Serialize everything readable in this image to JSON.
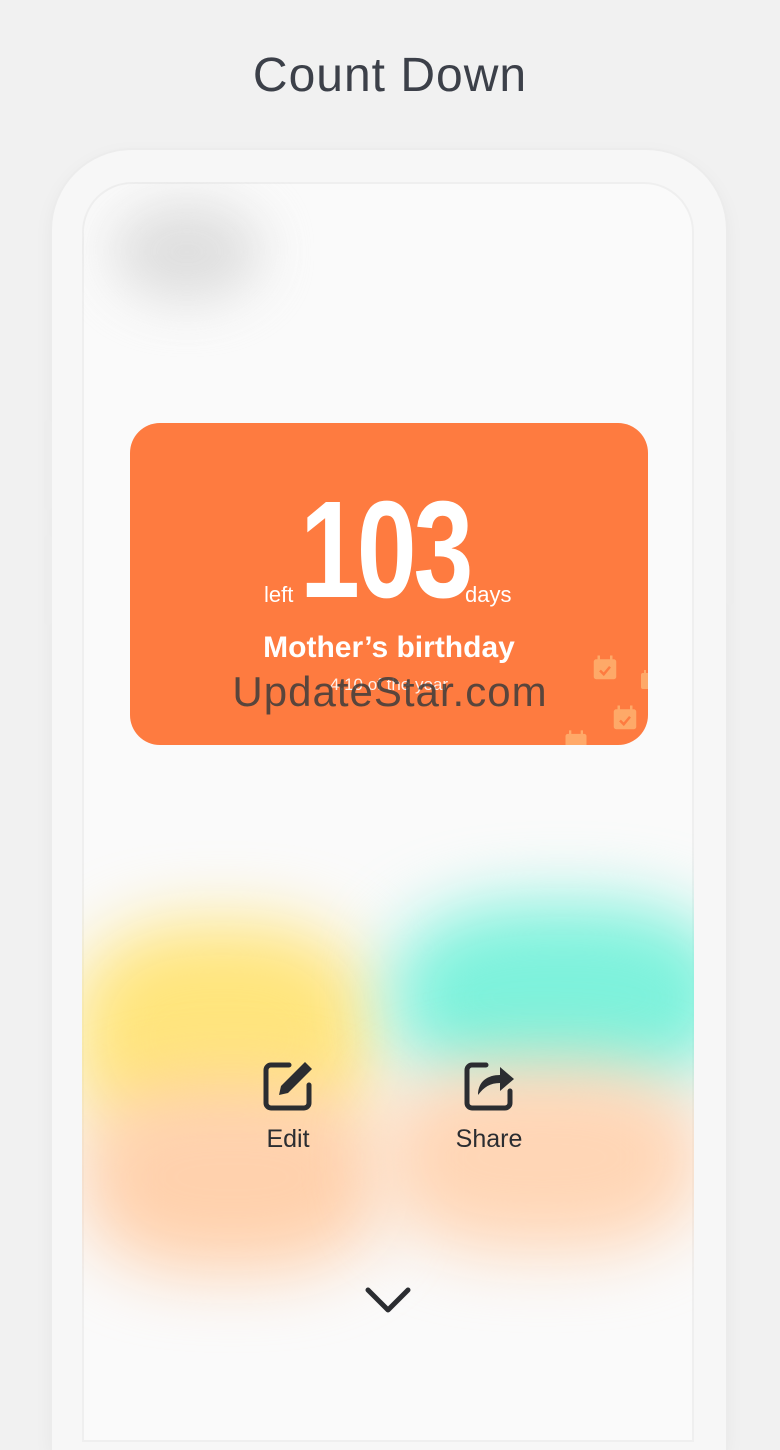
{
  "page": {
    "title": "Count Down"
  },
  "card": {
    "left_label": "left",
    "number": "103",
    "days_label": "days",
    "event_name": "Mother’s birthday",
    "date_text": "4.10 of the year",
    "background_color": "#fe7b40"
  },
  "actions": [
    {
      "label": "Edit",
      "icon": "edit-icon"
    },
    {
      "label": "Share",
      "icon": "share-icon"
    }
  ],
  "expand_icon": "chevron-down-icon",
  "watermark": "UpdateStar.com"
}
